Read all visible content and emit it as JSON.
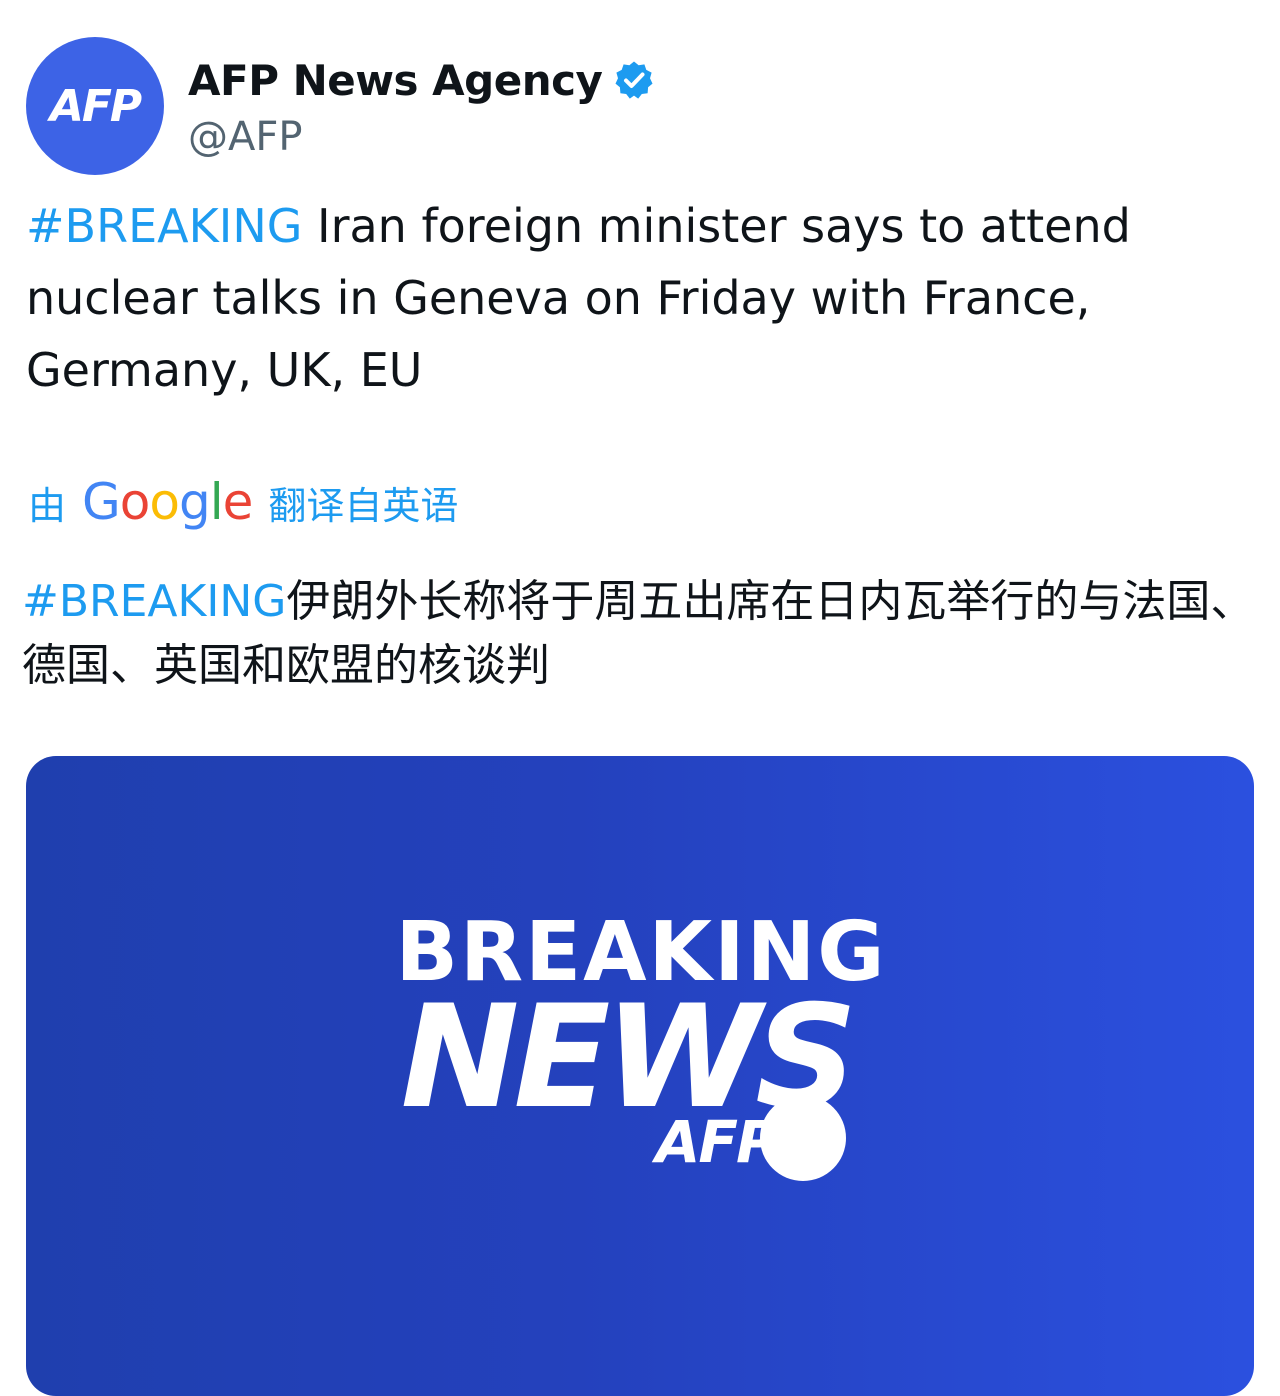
{
  "author": {
    "avatar_text": "AFP",
    "display_name": "AFP News Agency",
    "handle": "@AFP",
    "verified": true,
    "verified_color": "#1d9bf0",
    "avatar_color": "#3d63e6"
  },
  "tweet": {
    "hashtag": "#BREAKING",
    "text": " Iran foreign minister says to attend nuclear talks in Geneva on Friday with France, Germany, UK, EU"
  },
  "translation": {
    "prefix": "由",
    "provider": "Google",
    "suffix": "翻译自英语",
    "hashtag": "#BREAKING",
    "text": "伊朗外长称将于周五出席在日内瓦举行的与法国、德国、英国和欧盟的核谈判"
  },
  "media": {
    "line1": "BREAKING",
    "line2": "NEWS",
    "brand": "AFP",
    "background_color": "#2441bd"
  },
  "colors": {
    "link": "#1d9bf0",
    "text": "#0f1419",
    "secondary": "#536471"
  }
}
